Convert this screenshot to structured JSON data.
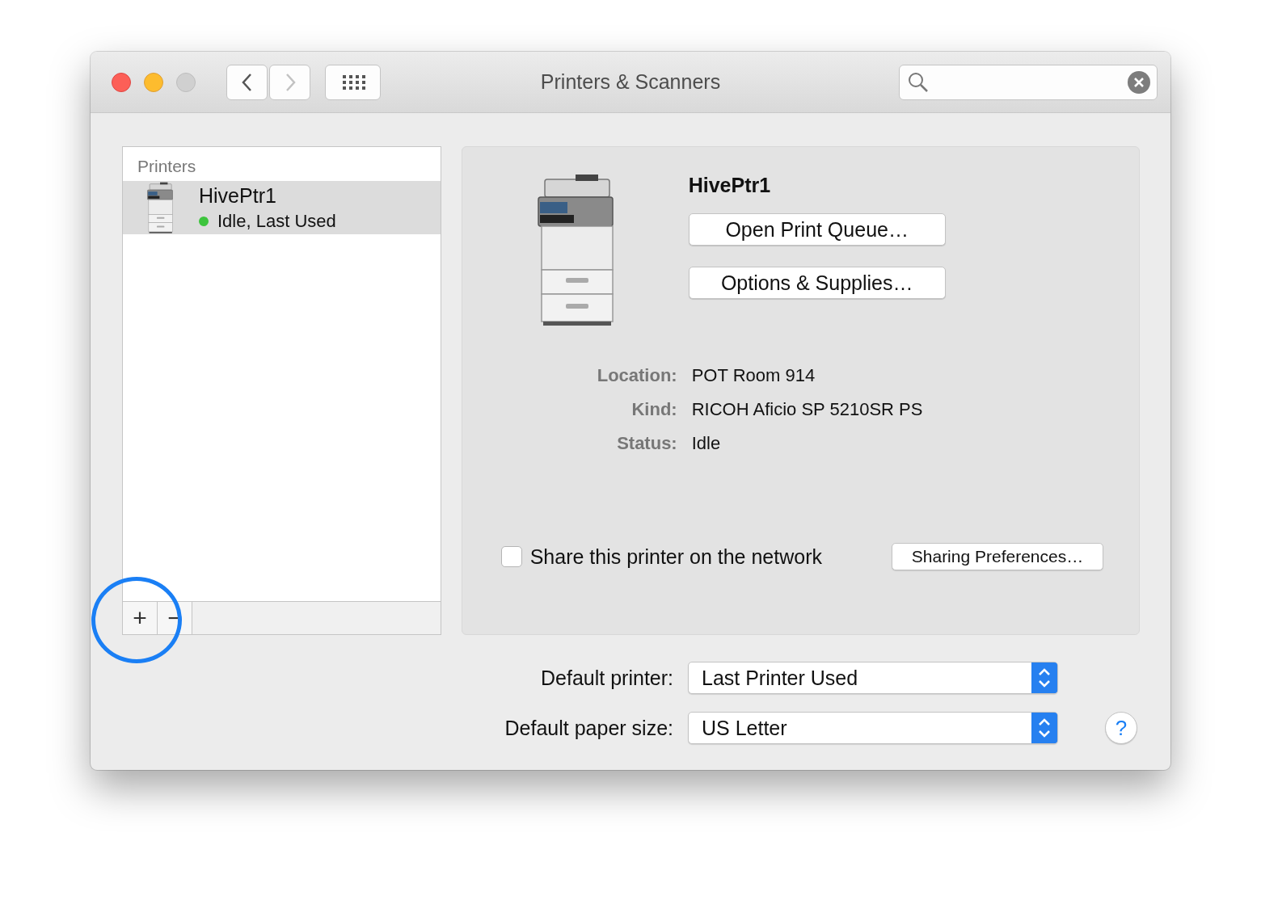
{
  "window": {
    "title": "Printers & Scanners"
  },
  "navigation": [
    {
      "kind": "back",
      "disabled": false
    },
    {
      "kind": "forward",
      "disabled": true
    }
  ],
  "printers_list": {
    "heading": "Printers",
    "items": [
      {
        "name": "HivePtr1",
        "status": "Idle, Last Used",
        "color": "#3dc43d",
        "selected": true
      }
    ]
  },
  "list_buttons": [
    "+",
    "−"
  ],
  "details": {
    "name": "HivePtr1",
    "buttons": [
      "Open Print Queue…",
      "Options & Supplies…"
    ],
    "fields": [
      {
        "label": "Location:",
        "value": "POT Room 914"
      },
      {
        "label": "Kind:",
        "value": "RICOH Aficio SP 5210SR PS"
      },
      {
        "label": "Status:",
        "value": "Idle"
      }
    ],
    "share": {
      "label": "Share this printer on the network",
      "checked": false
    },
    "sharing_button": "Sharing Preferences…"
  },
  "defaults": [
    {
      "label": "Default printer:",
      "value": "Last Printer Used"
    },
    {
      "label": "Default paper size:",
      "value": "US Letter"
    }
  ],
  "help": "?"
}
